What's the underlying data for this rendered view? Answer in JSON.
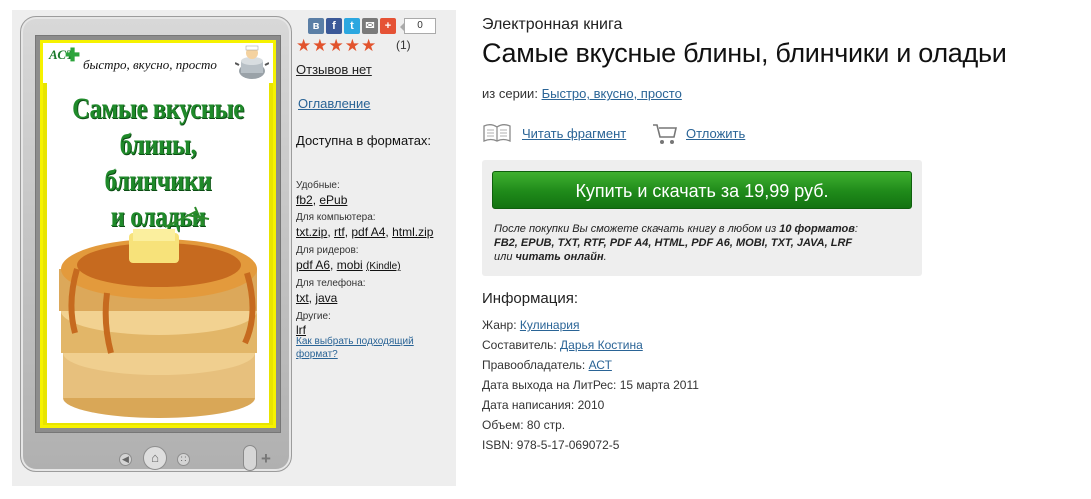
{
  "colors": {
    "link": "#2a6496",
    "buy_green": "#1f8a1a",
    "star": "#e2532d",
    "panel_bg": "#eeeeee"
  },
  "cover": {
    "publisher_logo": "АСТ",
    "slogan": "быстро, вкусно, просто",
    "title_line1": "Самые вкусные",
    "title_line2": "блины, блинчики",
    "title_line3": "и оладьи"
  },
  "share": {
    "buttons": [
      "vk-icon",
      "facebook-icon",
      "twitter-icon",
      "mail-icon",
      "plus-icon"
    ],
    "count": "0"
  },
  "rating": {
    "stars": 5,
    "max": 5,
    "stars_text": "★★★★★",
    "count": "(1)"
  },
  "reviews": "Отзывов нет",
  "toc": "Оглавление",
  "formats": {
    "title": "Доступна в форматах:",
    "groups": [
      {
        "label": "Удобные:",
        "links": [
          "fb2",
          "ePub"
        ]
      },
      {
        "label": "Для компьютера:",
        "links": [
          "txt.zip",
          "rtf",
          "pdf A4",
          "html.zip"
        ]
      },
      {
        "label": "Для ридеров:",
        "links": [
          "pdf A6",
          "mobi"
        ],
        "extra": "(Kindle)"
      },
      {
        "label": "Для телефона:",
        "links": [
          "txt",
          "java"
        ]
      },
      {
        "label": "Другие:",
        "links": [
          "lrf"
        ]
      }
    ],
    "choose": "Как выбрать подходящий формат?"
  },
  "book": {
    "kind": "Электронная книга",
    "title": "Самые вкусные блины, блинчики и оладьи",
    "series_prefix": "из серии:",
    "series": "Быстро, вкусно, просто"
  },
  "actions": {
    "read": "Читать фрагмент",
    "later": "Отложить"
  },
  "buy": {
    "button": "Купить и скачать за 19,99 руб.",
    "note_part1": "После покупки Вы сможете скачать книгу в любом из ",
    "note_bold": "10 форматов",
    "note_part2": ":",
    "note_formats": "FB2, EPUB, TXT, RTF, PDF A4, HTML, PDF A6, MOBI, TXT, JAVA, LRF",
    "note_or": "или ",
    "note_online": "читать онлайн",
    "note_end": "."
  },
  "info": {
    "title": "Информация:",
    "genre_label": "Жанр:",
    "genre": "Кулинария",
    "compiler_label": "Составитель:",
    "compiler": "Дарья Костина",
    "rights_label": "Правообладатель:",
    "rights": "АСТ",
    "release_label": "Дата выхода на ЛитРес:",
    "release": "15 марта 2011",
    "written_label": "Дата написания:",
    "written": "2010",
    "volume_label": "Объем:",
    "volume": "80 стр.",
    "isbn_label": "ISBN:",
    "isbn": "978-5-17-069072-5"
  }
}
